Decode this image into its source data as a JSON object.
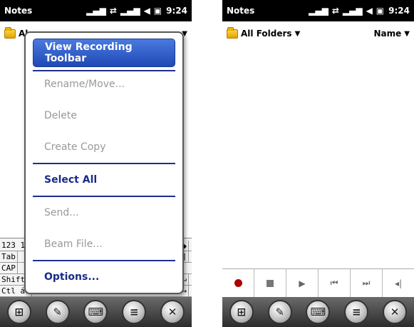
{
  "left": {
    "status": {
      "app_title": "Notes",
      "time": "9:24"
    },
    "folder_label_partial": "Al",
    "menu": {
      "items": [
        {
          "label": "View Recording Toolbar",
          "state": "selected"
        },
        {
          "label": "Rename/Move...",
          "state": "disabled"
        },
        {
          "label": "Delete",
          "state": "disabled"
        },
        {
          "label": "Create Copy",
          "state": "disabled"
        },
        {
          "label": "Select All",
          "state": "enabled"
        },
        {
          "label": "Send...",
          "state": "disabled"
        },
        {
          "label": "Beam File...",
          "state": "disabled"
        },
        {
          "label": "Options...",
          "state": "enabled"
        }
      ]
    },
    "keyboard": {
      "row1": "123 1",
      "row2": "Tab",
      "row3": "CAP",
      "row4": "Shift",
      "row5": "Ctl áü",
      "right1": "]",
      "right2": "↵",
      "right3": "↓ ↑ ← →"
    }
  },
  "right": {
    "status": {
      "app_title": "Notes",
      "time": "9:24"
    },
    "folder_label": "All Folders",
    "sort_label": "Name"
  },
  "icons": {
    "status_icons": [
      "signal-icon",
      "sync-icon",
      "signal-icon",
      "speaker-icon",
      "battery-icon"
    ],
    "softkeys": [
      "windows-start-icon",
      "notes-icon",
      "keyboard-icon",
      "menu-icon",
      "close-icon"
    ],
    "recording": [
      "record-icon",
      "stop-icon",
      "play-icon",
      "rewind-icon",
      "fast-forward-icon",
      "volume-icon"
    ]
  },
  "colors": {
    "menu_selected": "#2a55c8",
    "menu_enabled_text": "#1a2a8a",
    "record_red": "#a00000"
  }
}
